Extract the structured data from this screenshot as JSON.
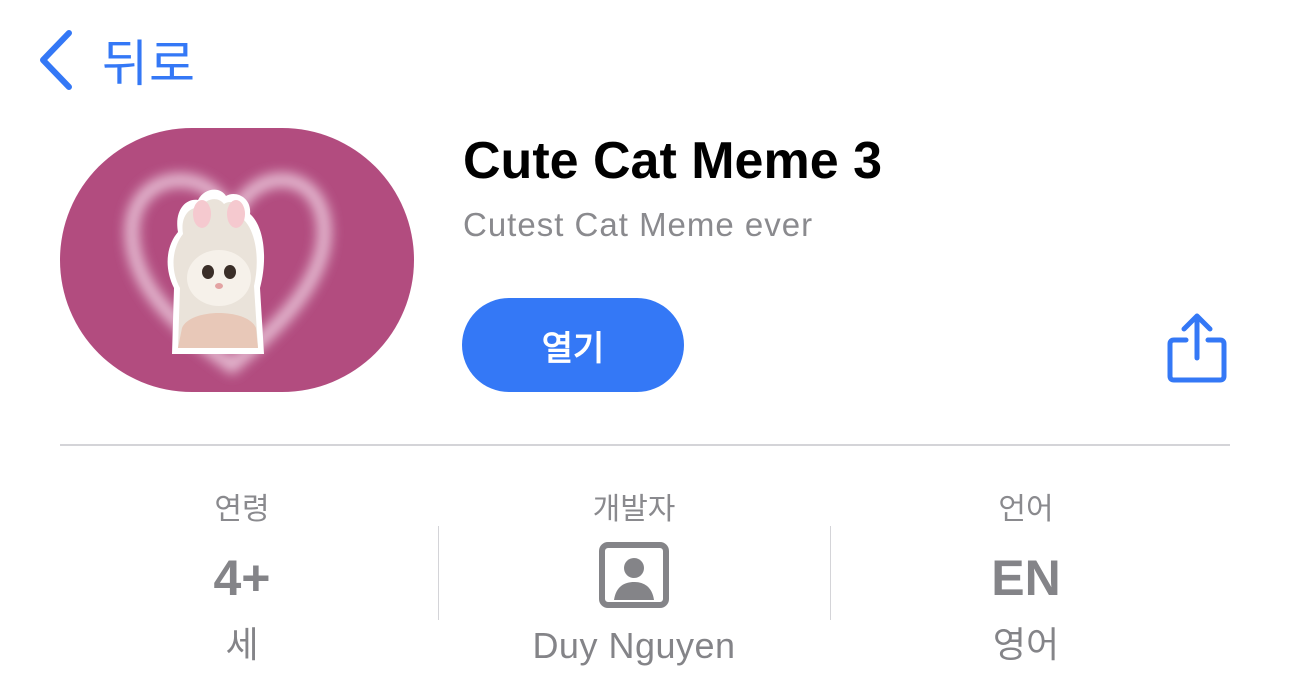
{
  "nav": {
    "back_label": "뒤로",
    "back_icon": "chevron-left-icon"
  },
  "app": {
    "title": "Cute Cat Meme 3",
    "subtitle": "Cutest Cat Meme ever",
    "open_label": "열기",
    "share_icon": "share-icon"
  },
  "info": {
    "age": {
      "heading": "연령",
      "value": "4+",
      "sub": "세"
    },
    "developer": {
      "heading": "개발자",
      "icon": "person-square-icon",
      "sub": "Duy Nguyen"
    },
    "language": {
      "heading": "언어",
      "value": "EN",
      "sub": "영어"
    }
  },
  "colors": {
    "accent": "#3478f6",
    "icon_background": "#b24c7f",
    "secondary_text": "#8a8a8e",
    "divider": "#d4d4d8"
  }
}
